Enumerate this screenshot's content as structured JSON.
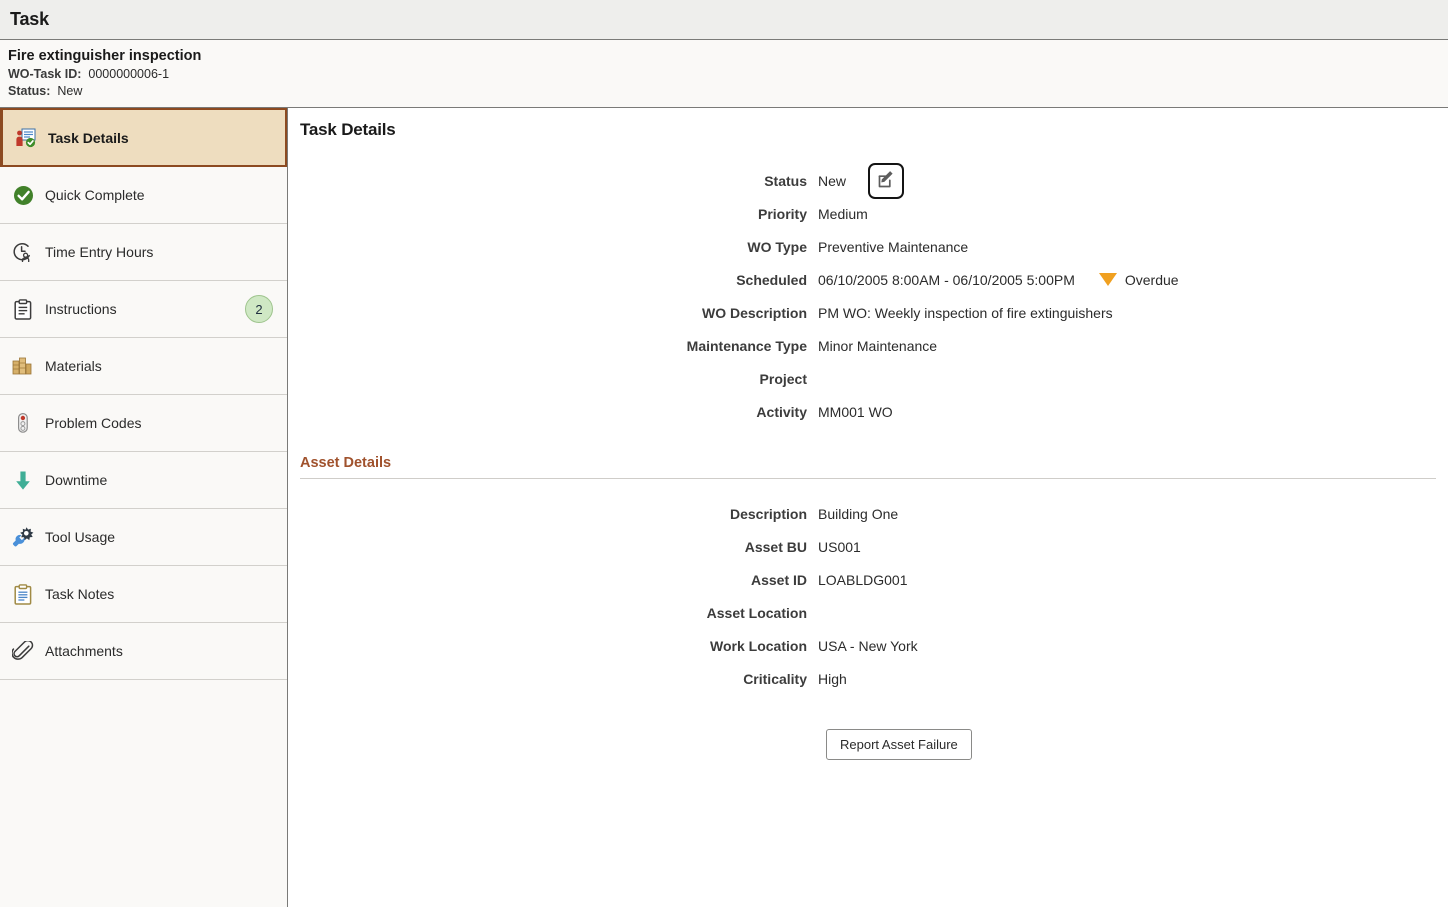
{
  "app": {
    "title": "Task"
  },
  "task_header": {
    "title": "Fire extinguisher inspection",
    "wo_task_id_label": "WO-Task ID:",
    "wo_task_id_value": "0000000006-1",
    "status_label": "Status:",
    "status_value": "New"
  },
  "sidebar": {
    "items": [
      {
        "label": "Task Details",
        "icon": "task-details-icon",
        "badge": "",
        "active": true
      },
      {
        "label": "Quick Complete",
        "icon": "check-circle-icon",
        "badge": "",
        "active": false
      },
      {
        "label": "Time Entry Hours",
        "icon": "clock-person-icon",
        "badge": "",
        "active": false
      },
      {
        "label": "Instructions",
        "icon": "clipboard-icon",
        "badge": "2",
        "active": false
      },
      {
        "label": "Materials",
        "icon": "materials-icon",
        "badge": "",
        "active": false
      },
      {
        "label": "Problem Codes",
        "icon": "traffic-light-icon",
        "badge": "",
        "active": false
      },
      {
        "label": "Downtime",
        "icon": "down-arrow-icon",
        "badge": "",
        "active": false
      },
      {
        "label": "Tool Usage",
        "icon": "wrench-gear-icon",
        "badge": "",
        "active": false
      },
      {
        "label": "Task Notes",
        "icon": "notes-clipboard-icon",
        "badge": "",
        "active": false
      },
      {
        "label": "Attachments",
        "icon": "paperclip-icon",
        "badge": "",
        "active": false
      }
    ]
  },
  "main": {
    "title": "Task Details",
    "fields": [
      {
        "label": "Status",
        "value": "New"
      },
      {
        "label": "Priority",
        "value": "Medium"
      },
      {
        "label": "WO Type",
        "value": "Preventive Maintenance"
      },
      {
        "label": "Scheduled",
        "value": "06/10/2005  8:00AM  - 06/10/2005  5:00PM"
      },
      {
        "label": "WO Description",
        "value": "PM WO: Weekly inspection of fire extinguishers"
      },
      {
        "label": "Maintenance Type",
        "value": "Minor Maintenance"
      },
      {
        "label": "Project",
        "value": ""
      },
      {
        "label": "Activity",
        "value": "MM001 WO"
      }
    ],
    "overdue_text": "Overdue",
    "edit_icon": "edit-pencil-icon"
  },
  "asset_details": {
    "heading": "Asset Details",
    "fields": [
      {
        "label": "Description",
        "value": "Building One"
      },
      {
        "label": "Asset BU",
        "value": "US001"
      },
      {
        "label": "Asset ID",
        "value": "LOABLDG001"
      },
      {
        "label": "Asset Location",
        "value": ""
      },
      {
        "label": "Work Location",
        "value": "USA - New York"
      },
      {
        "label": "Criticality",
        "value": "High"
      }
    ],
    "report_failure_button": "Report Asset Failure"
  },
  "colors": {
    "active_nav_bg": "#eeddbf",
    "active_nav_border": "#8c4a21",
    "section_heading": "#a0522d",
    "badge_bg": "#cfe8c4",
    "overdue": "#f0a020",
    "check_green": "#41812a"
  }
}
